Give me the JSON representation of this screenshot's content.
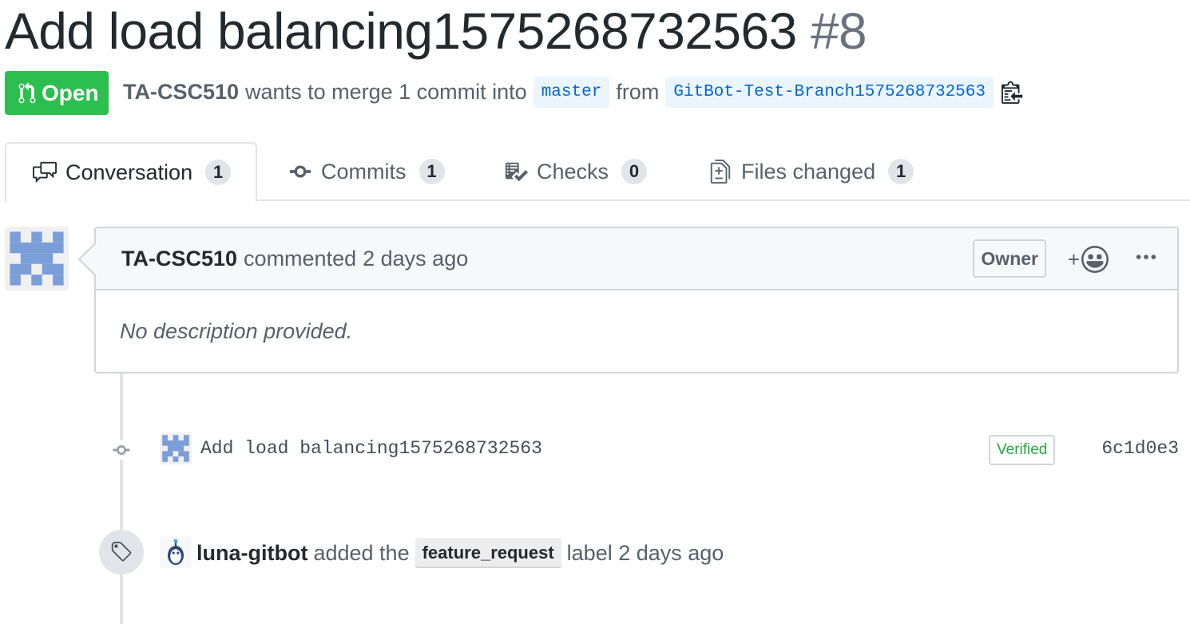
{
  "pr": {
    "title": "Add load balancing1575268732563",
    "number": "#8",
    "state": "Open",
    "author": "TA-CSC510",
    "merge_text": "wants to merge 1 commit into",
    "base_branch": "master",
    "from_text": "from",
    "head_branch": "GitBot-Test-Branch1575268732563"
  },
  "tabs": [
    {
      "label": "Conversation",
      "count": "1",
      "icon": "comment-discussion-icon",
      "selected": true
    },
    {
      "label": "Commits",
      "count": "1",
      "icon": "git-commit-icon",
      "selected": false
    },
    {
      "label": "Checks",
      "count": "0",
      "icon": "checklist-icon",
      "selected": false
    },
    {
      "label": "Files changed",
      "count": "1",
      "icon": "file-diff-icon",
      "selected": false
    }
  ],
  "comment": {
    "author": "TA-CSC510",
    "action_text": "commented",
    "time": "2 days ago",
    "role_badge": "Owner",
    "reaction_plus": "+",
    "body": "No description provided."
  },
  "commit": {
    "message": "Add load balancing1575268732563",
    "verified": "Verified",
    "sha": "6c1d0e3"
  },
  "label_event": {
    "actor": "luna-gitbot",
    "text_before": "added the",
    "label": "feature_request",
    "text_after": "label 2 days ago"
  },
  "colors": {
    "open_green": "#2cbe4e",
    "link_blue": "#0366d6",
    "identicon_blue": "#7b9ed8",
    "label_bg": "#ededed"
  }
}
